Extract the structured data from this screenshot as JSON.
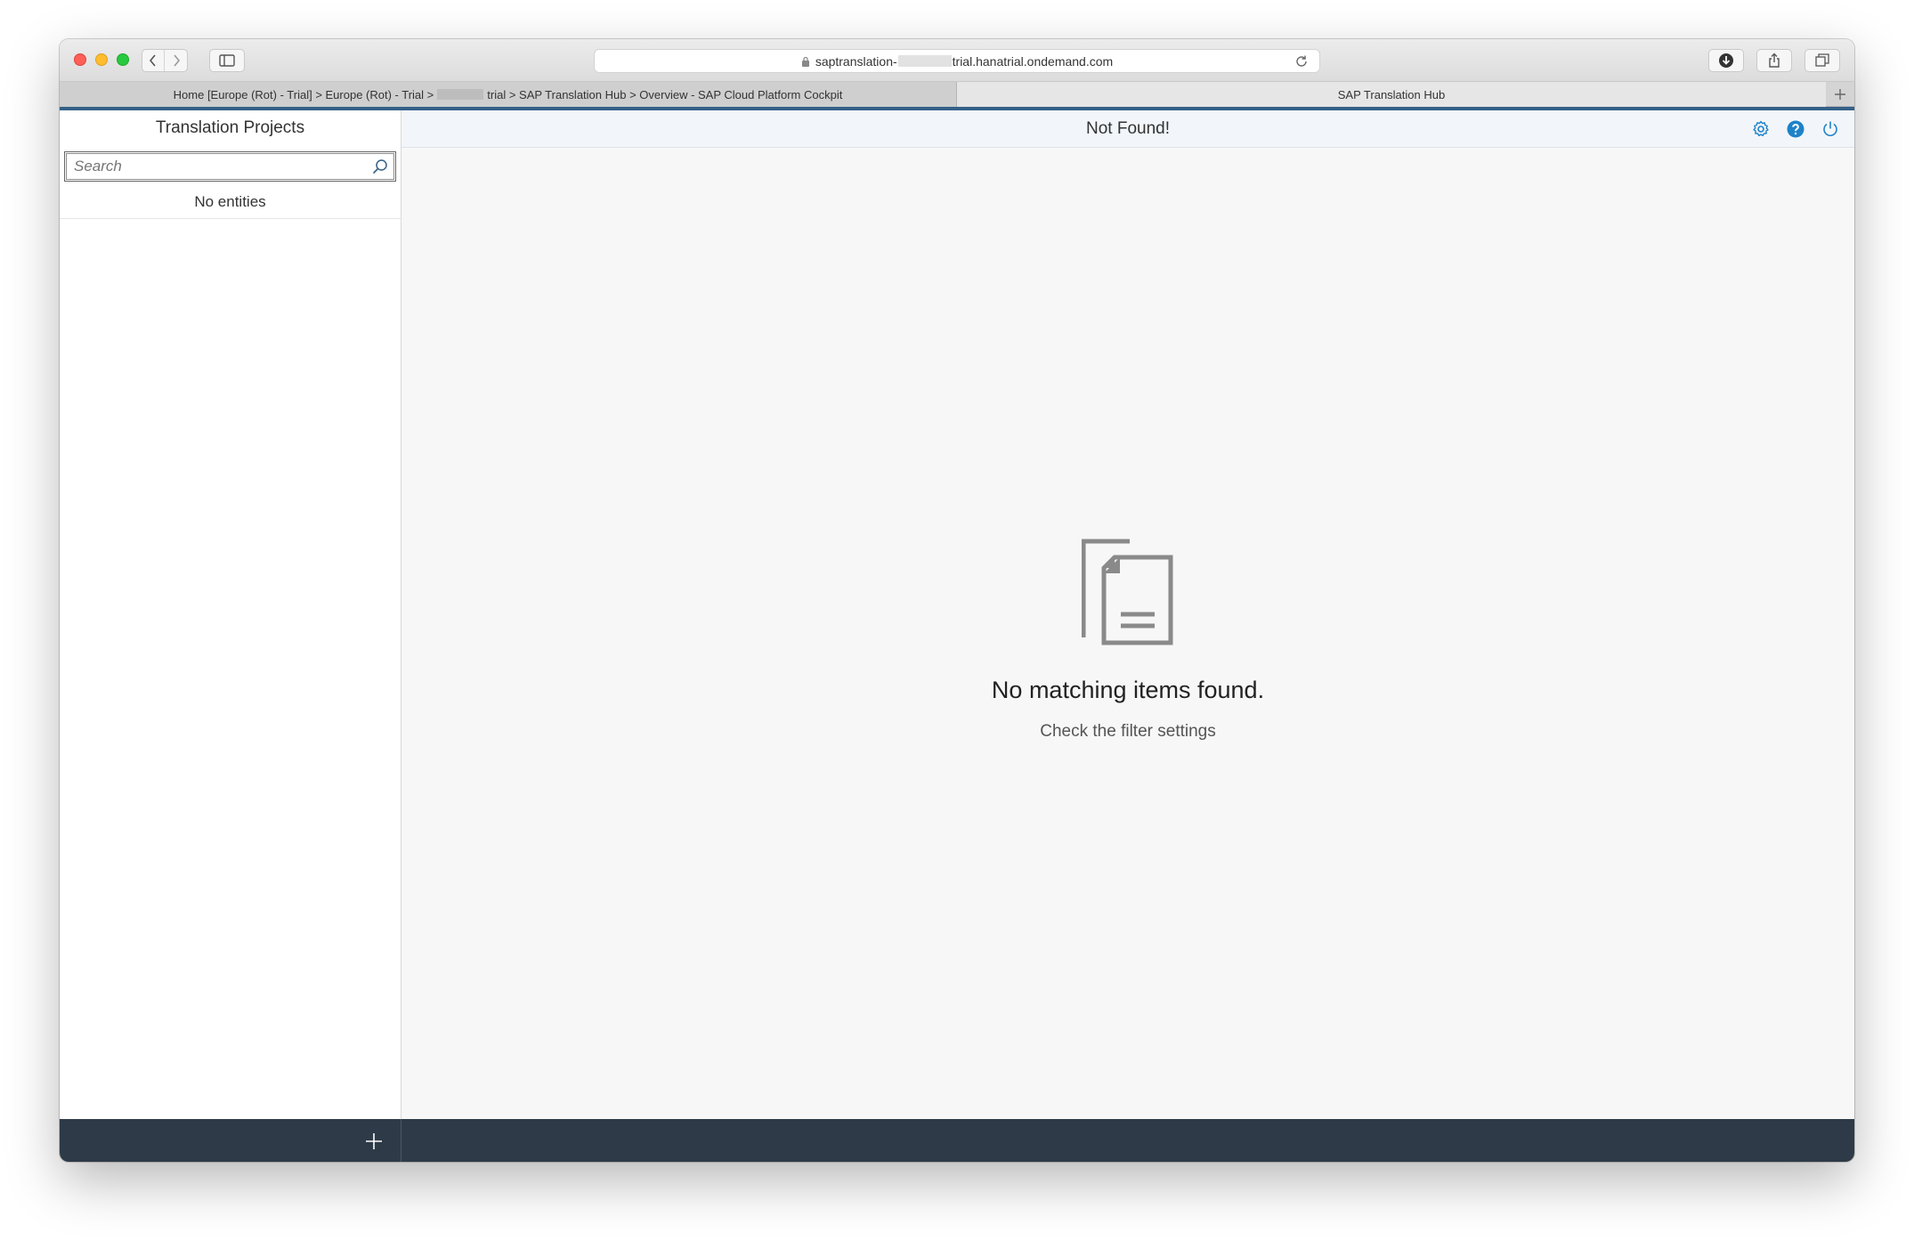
{
  "browser": {
    "url_prefix": "saptranslation-",
    "url_suffix": "trial.hanatrial.ondemand.com",
    "tabs": [
      {
        "label_part1": "Home [Europe (Rot) - Trial] > Europe (Rot) - Trial >",
        "label_part2": "trial > SAP Translation Hub > Overview - SAP Cloud Platform Cockpit"
      },
      {
        "label": "SAP Translation Hub"
      }
    ],
    "icons": {
      "back": "chevron-left-icon",
      "forward": "chevron-right-icon",
      "sidebar": "sidebar-icon",
      "lock": "lock-icon",
      "reload": "reload-icon",
      "download": "download-icon",
      "share": "share-icon",
      "tabs": "tabs-overview-icon",
      "new_tab": "plus-icon"
    }
  },
  "master": {
    "title": "Translation Projects",
    "search_placeholder": "Search",
    "empty_text": "No entities"
  },
  "detail": {
    "title": "Not Found!",
    "empty_title": "No matching items found.",
    "empty_subtitle": "Check the filter settings",
    "icons": [
      "settings-icon",
      "help-icon",
      "logout-icon"
    ]
  },
  "colors": {
    "accent": "#346187",
    "icon_blue": "#1f82c8",
    "footer": "#2e3a47"
  }
}
